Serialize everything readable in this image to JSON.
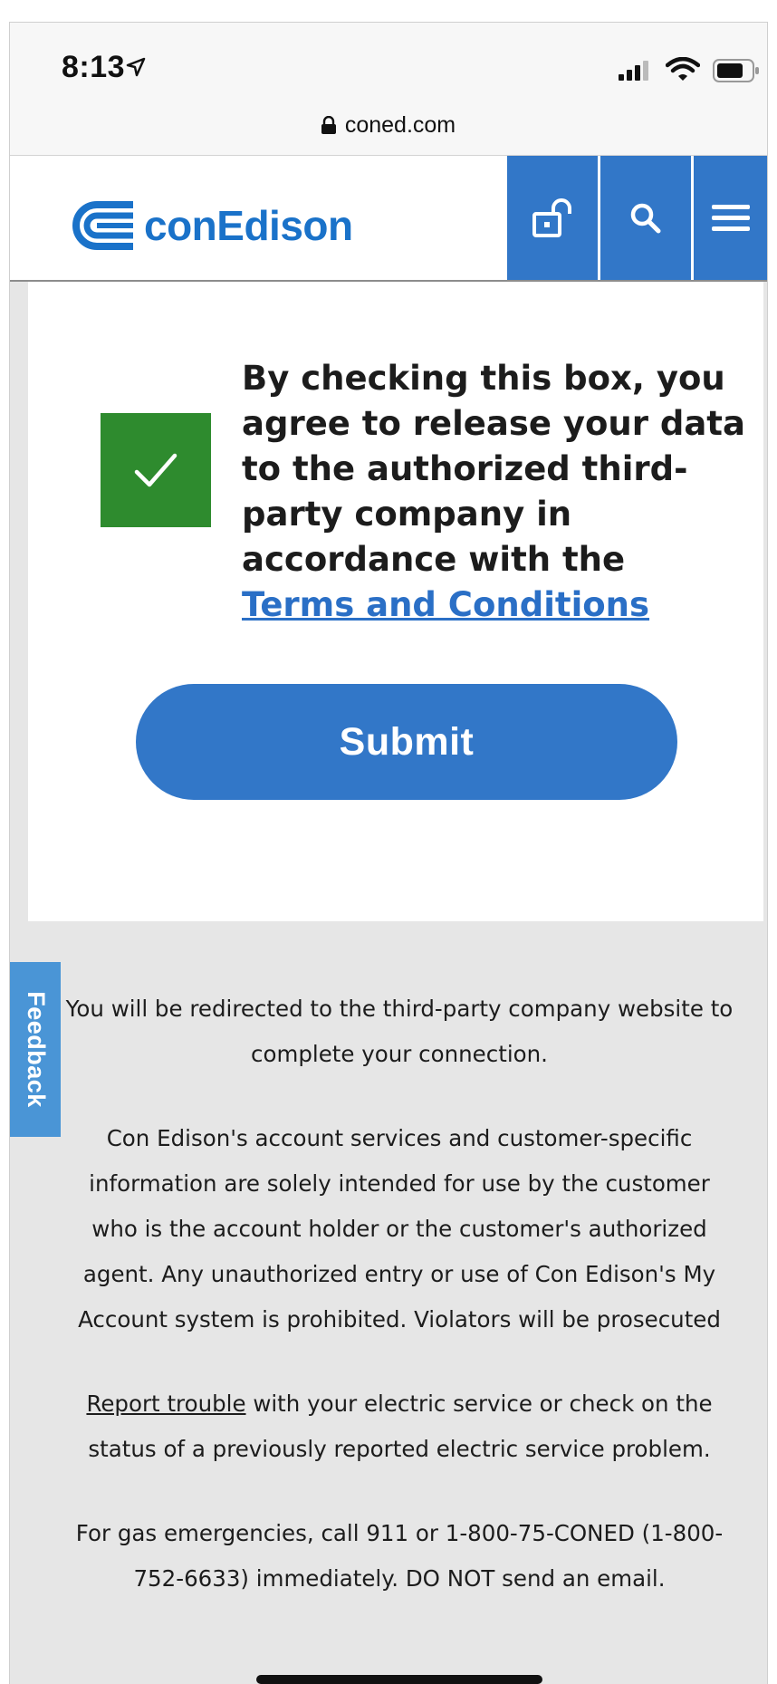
{
  "status_bar": {
    "time": "8:13"
  },
  "url_bar": {
    "domain": "coned.com"
  },
  "header": {
    "logo_text": "conEdison",
    "brand_color": "#3277c8"
  },
  "consent": {
    "checked": true,
    "text": "By checking this box, you agree to release your data to the authorized third-party company in accordance with the",
    "terms_link": "Terms and Conditions"
  },
  "submit_label": "Submit",
  "feedback_label": "Feedback",
  "footer": {
    "redirect_note": "You will be redirected to the third-party company website to complete your connection.",
    "legal_notice": "Con Edison's account services and customer-specific information are solely intended for use by the customer who is the account holder or the customer's authorized agent. Any unauthorized entry or use of Con Edison's My Account system is prohibited. Violators will be prosecuted",
    "report_link": "Report trouble",
    "report_text": " with your electric service or check on the status of a previously reported electric service problem.",
    "gas_emergency": "For gas emergencies, call 911 or 1-800-75-CONED (1-800-752-6633) immediately. DO NOT send an email."
  }
}
